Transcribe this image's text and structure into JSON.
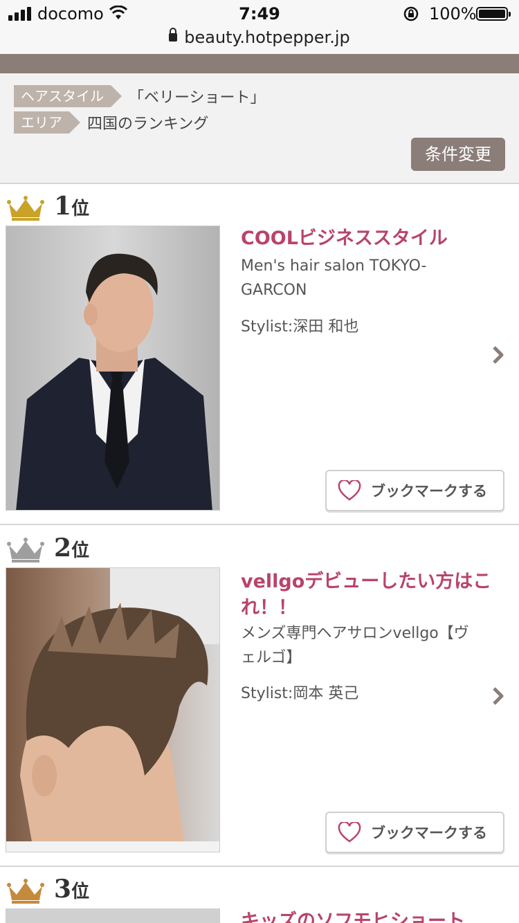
{
  "status_bar": {
    "carrier": "docomo",
    "time": "7:49",
    "battery": "100%"
  },
  "url_bar": {
    "url": "beauty.hotpepper.jp"
  },
  "conditions": {
    "hairstyle_tag": "ヘアスタイル",
    "hairstyle_value": "「ベリーショート」",
    "area_tag": "エリア",
    "area_value": "四国のランキング",
    "change_button": "条件変更"
  },
  "rankings": [
    {
      "rank": "1",
      "rank_suffix": "位",
      "title": "COOLビジネススタイル",
      "salon": "Men's hair salon TOKYO-GARCON",
      "stylist": "Stylist:深田 和也",
      "bookmark": "ブックマークする",
      "crown_color": "#c9a227"
    },
    {
      "rank": "2",
      "rank_suffix": "位",
      "title": "vellgoデビューしたい方はこれ！！",
      "salon": "メンズ専門ヘアサロンvellgo【ヴェルゴ】",
      "stylist": "Stylist:岡本 英己",
      "bookmark": "ブックマークする",
      "crown_color": "#9e9e9e"
    },
    {
      "rank": "3",
      "rank_suffix": "位",
      "title": "キッズのソフモヒショート",
      "crown_color": "#c58a3c"
    }
  ],
  "colors": {
    "accent": "#b8446a",
    "brand_brown": "#8b7d78",
    "tag_bg": "#bdb3ab"
  }
}
